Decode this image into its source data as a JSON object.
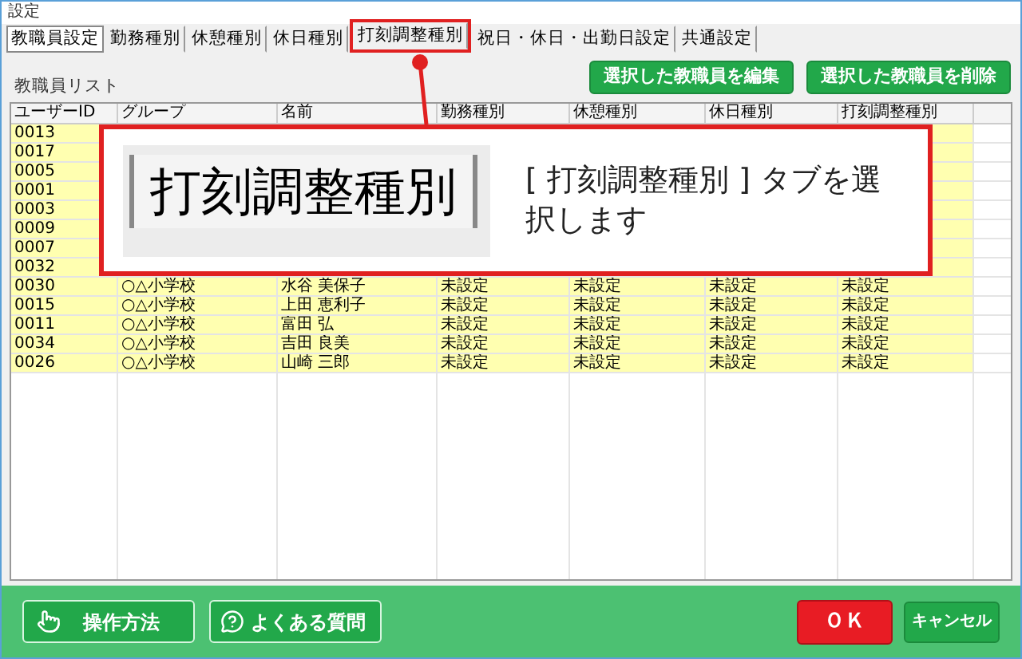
{
  "window": {
    "title": "設定"
  },
  "tabs": [
    {
      "label": "教職員設定",
      "selected": true,
      "highlighted": false
    },
    {
      "label": "勤務種別",
      "selected": false,
      "highlighted": false
    },
    {
      "label": "休憩種別",
      "selected": false,
      "highlighted": false
    },
    {
      "label": "休日種別",
      "selected": false,
      "highlighted": false
    },
    {
      "label": "打刻調整種別",
      "selected": false,
      "highlighted": true
    },
    {
      "label": "祝日・休日・出勤日設定",
      "selected": false,
      "highlighted": false
    },
    {
      "label": "共通設定",
      "selected": false,
      "highlighted": false
    }
  ],
  "list_label": "教職員リスト",
  "action_buttons": [
    "選択した教職員を編集",
    "選択した教職員を削除"
  ],
  "table": {
    "columns": [
      "ユーザーID",
      "グループ",
      "名前",
      "勤務種別",
      "休憩種別",
      "休日種別",
      "打刻調整種別"
    ],
    "rows": [
      {
        "cells": [
          "0013"
        ]
      },
      {
        "cells": [
          "0017"
        ]
      },
      {
        "cells": [
          "0005"
        ]
      },
      {
        "cells": [
          "0001"
        ]
      },
      {
        "cells": [
          "0003"
        ]
      },
      {
        "cells": [
          "0009"
        ]
      },
      {
        "cells": [
          "0007"
        ]
      },
      {
        "cells": [
          "0032"
        ]
      },
      {
        "cells": [
          "0030",
          "○△小学校",
          "水谷 美保子",
          "未設定",
          "未設定",
          "未設定",
          "未設定"
        ]
      },
      {
        "cells": [
          "0015",
          "○△小学校",
          "上田 恵利子",
          "未設定",
          "未設定",
          "未設定",
          "未設定"
        ]
      },
      {
        "cells": [
          "0011",
          "○△小学校",
          "富田 弘",
          "未設定",
          "未設定",
          "未設定",
          "未設定"
        ]
      },
      {
        "cells": [
          "0034",
          "○△小学校",
          "吉田 良美",
          "未設定",
          "未設定",
          "未設定",
          "未設定"
        ]
      },
      {
        "cells": [
          "0026",
          "○△小学校",
          "山崎 三郎",
          "未設定",
          "未設定",
          "未設定",
          "未設定"
        ]
      }
    ]
  },
  "callout": {
    "tab_image_label": "打刻調整種別",
    "text": "[ 打刻調整種別 ] タブを選択します"
  },
  "footer_buttons": [
    {
      "kind": "help",
      "label": "操作方法"
    },
    {
      "kind": "faq",
      "label": "よくある質問"
    },
    {
      "kind": "ok",
      "label": "ＯＫ"
    },
    {
      "kind": "cancel",
      "label": "キャンセル"
    }
  ]
}
